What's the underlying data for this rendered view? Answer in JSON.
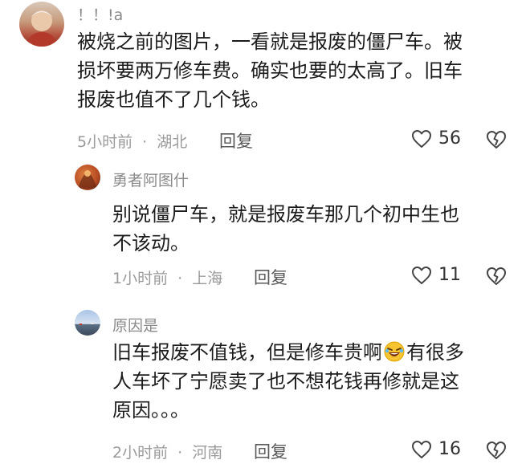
{
  "comments": [
    {
      "username": "！！!a",
      "lines": [
        "被烧之前的图片，一看就是报废的僵尸车。被",
        "损坏要两万修车费。确实也要的太高了。旧车",
        "报废也值不了几个钱。"
      ],
      "time": "5小时前",
      "location": "湖北",
      "reply_label": "回复",
      "likes": "56"
    },
    {
      "username": "勇者阿图什",
      "lines": [
        "别说僵尸车，就是报废车那几个初中生也",
        "不该动。"
      ],
      "time": "1小时前",
      "location": "上海",
      "reply_label": "回复",
      "likes": "11"
    },
    {
      "username": "原因是",
      "lines": [
        "旧车报废不值钱，但是修车贵啊",
        "有很多",
        "人车坏了宁愿卖了也不想花钱再修就是这",
        "原因。。。"
      ],
      "time": "2小时前",
      "location": "河南",
      "reply_label": "回复",
      "likes": "16"
    }
  ],
  "meta_separator": "·",
  "icons": [
    "heart-outline-icon",
    "broken-heart-icon",
    "laughing-emoji-icon"
  ]
}
